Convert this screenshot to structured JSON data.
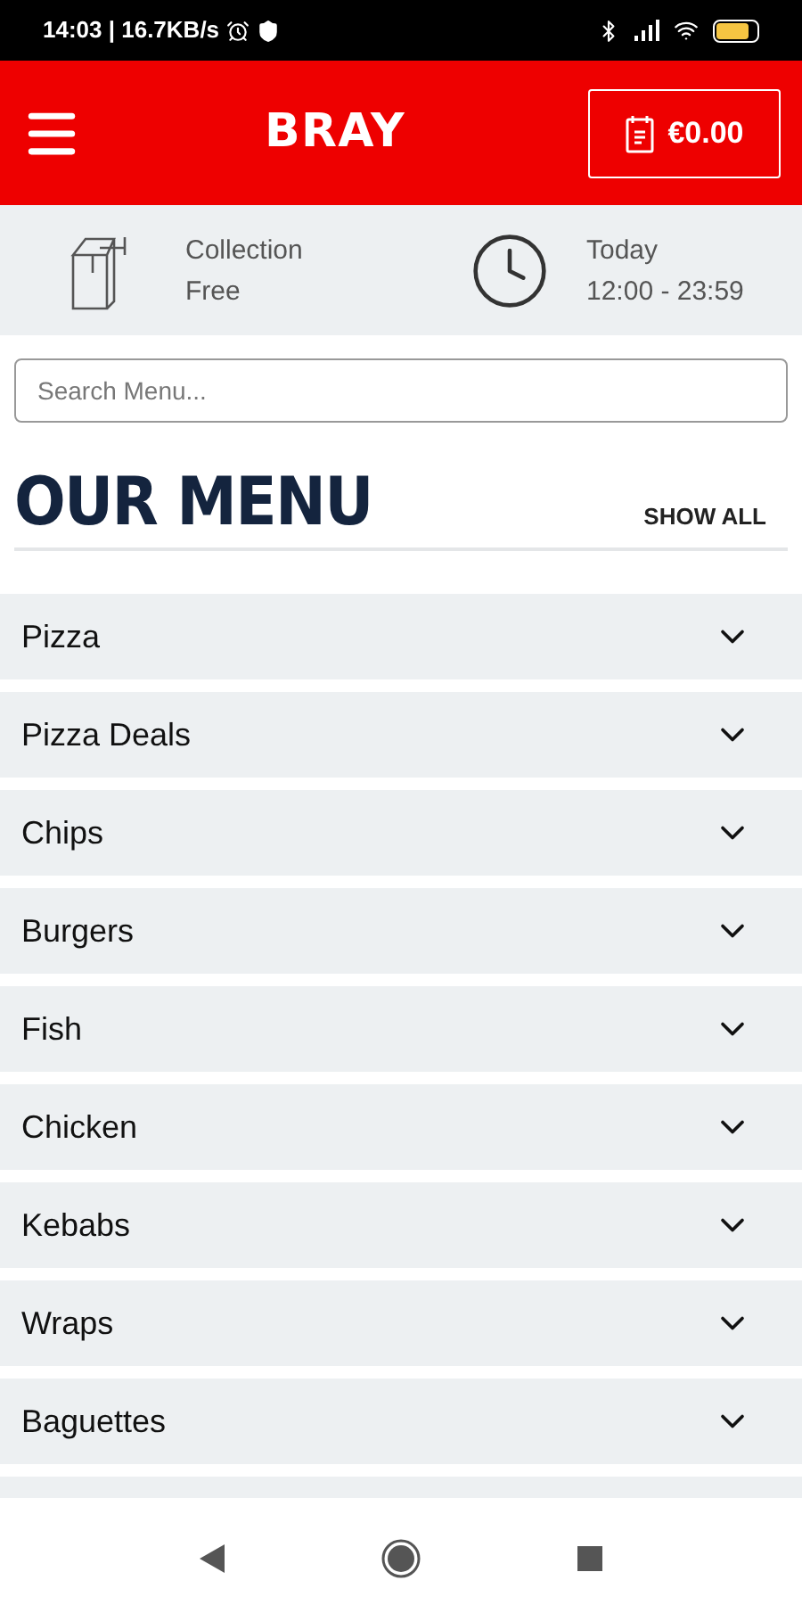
{
  "status_bar": {
    "text": "14:03 | 16.7KB/s"
  },
  "header": {
    "title": "BRAY",
    "cart_total": "€0.00"
  },
  "info": [
    {
      "kind": "collection",
      "label": "Collection",
      "value": "Free"
    },
    {
      "kind": "time",
      "label": "Today",
      "value": "12:00 - 23:59"
    }
  ],
  "search": {
    "placeholder": "Search Menu..."
  },
  "menu": {
    "title": "OUR MENU",
    "show_all": "SHOW ALL"
  },
  "categories": [
    {
      "label": "Pizza",
      "expanded": false
    },
    {
      "label": "Pizza Deals",
      "expanded": false
    },
    {
      "label": "Chips",
      "expanded": false
    },
    {
      "label": "Burgers",
      "expanded": false
    },
    {
      "label": "Fish",
      "expanded": false
    },
    {
      "label": "Chicken",
      "expanded": false
    },
    {
      "label": "Kebabs",
      "expanded": false
    },
    {
      "label": "Wraps",
      "expanded": false
    },
    {
      "label": "Baguettes",
      "expanded": false
    }
  ]
}
